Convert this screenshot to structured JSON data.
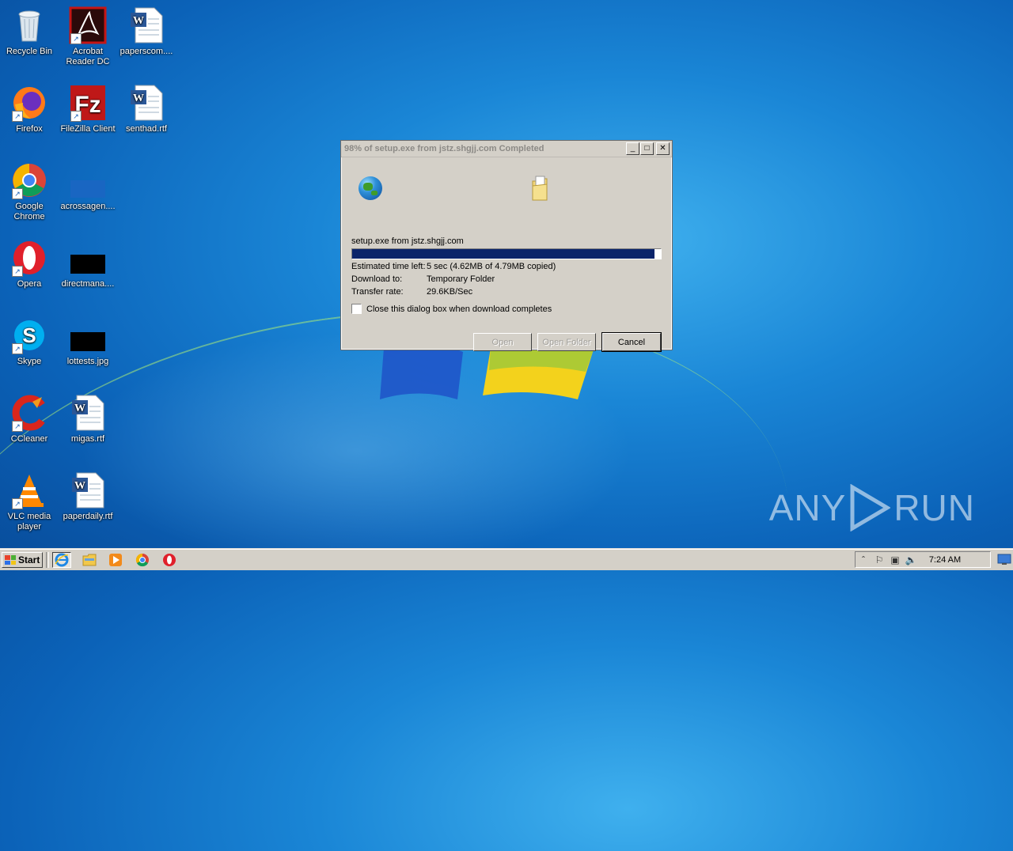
{
  "desktop": {
    "icons": [
      {
        "label": "Recycle Bin",
        "icon": "recycle-bin-icon"
      },
      {
        "label": "Acrobat Reader DC",
        "icon": "acrobat-icon"
      },
      {
        "label": "paperscom....",
        "icon": "word-document-icon"
      },
      {
        "label": "Firefox",
        "icon": "firefox-icon"
      },
      {
        "label": "FileZilla Client",
        "icon": "filezilla-icon"
      },
      {
        "label": "senthad.rtf",
        "icon": "word-document-icon"
      },
      {
        "label": "Google Chrome",
        "icon": "chrome-icon"
      },
      {
        "label": "acrossagen....",
        "icon": "blank-file-icon"
      },
      {
        "label": "Opera",
        "icon": "opera-icon"
      },
      {
        "label": "directmana....",
        "icon": "black-image-icon"
      },
      {
        "label": "Skype",
        "icon": "skype-icon"
      },
      {
        "label": "lottests.jpg",
        "icon": "black-image-icon"
      },
      {
        "label": "CCleaner",
        "icon": "ccleaner-icon"
      },
      {
        "label": "migas.rtf",
        "icon": "word-document-icon"
      },
      {
        "label": "VLC media player",
        "icon": "vlc-icon"
      },
      {
        "label": "paperdaily.rtf",
        "icon": "word-document-icon"
      }
    ]
  },
  "dialog": {
    "title": "98% of setup.exe from jstz.shgjj.com Completed",
    "filename": "setup.exe from jstz.shgjj.com",
    "progress_percent": 98,
    "estimated_label": "Estimated time left:",
    "estimated_value": "5 sec (4.62MB of 4.79MB copied)",
    "download_to_label": "Download to:",
    "download_to_value": "Temporary Folder",
    "transfer_label": "Transfer rate:",
    "transfer_value": "29.6KB/Sec",
    "close_checkbox_label": "Close this dialog box when download completes",
    "close_checkbox_checked": false,
    "buttons": {
      "open": "Open",
      "open_folder": "Open Folder",
      "cancel": "Cancel"
    },
    "title_buttons": {
      "minimize": "_",
      "maximize": "□",
      "close": "✕"
    }
  },
  "watermark": {
    "left": "ANY",
    "right": "RUN"
  },
  "taskbar": {
    "start_label": "Start",
    "quicklaunch": [
      "internet-explorer-icon",
      "explorer-folder-icon",
      "media-player-icon",
      "chrome-icon",
      "opera-icon"
    ],
    "clock": "7:24 AM"
  }
}
